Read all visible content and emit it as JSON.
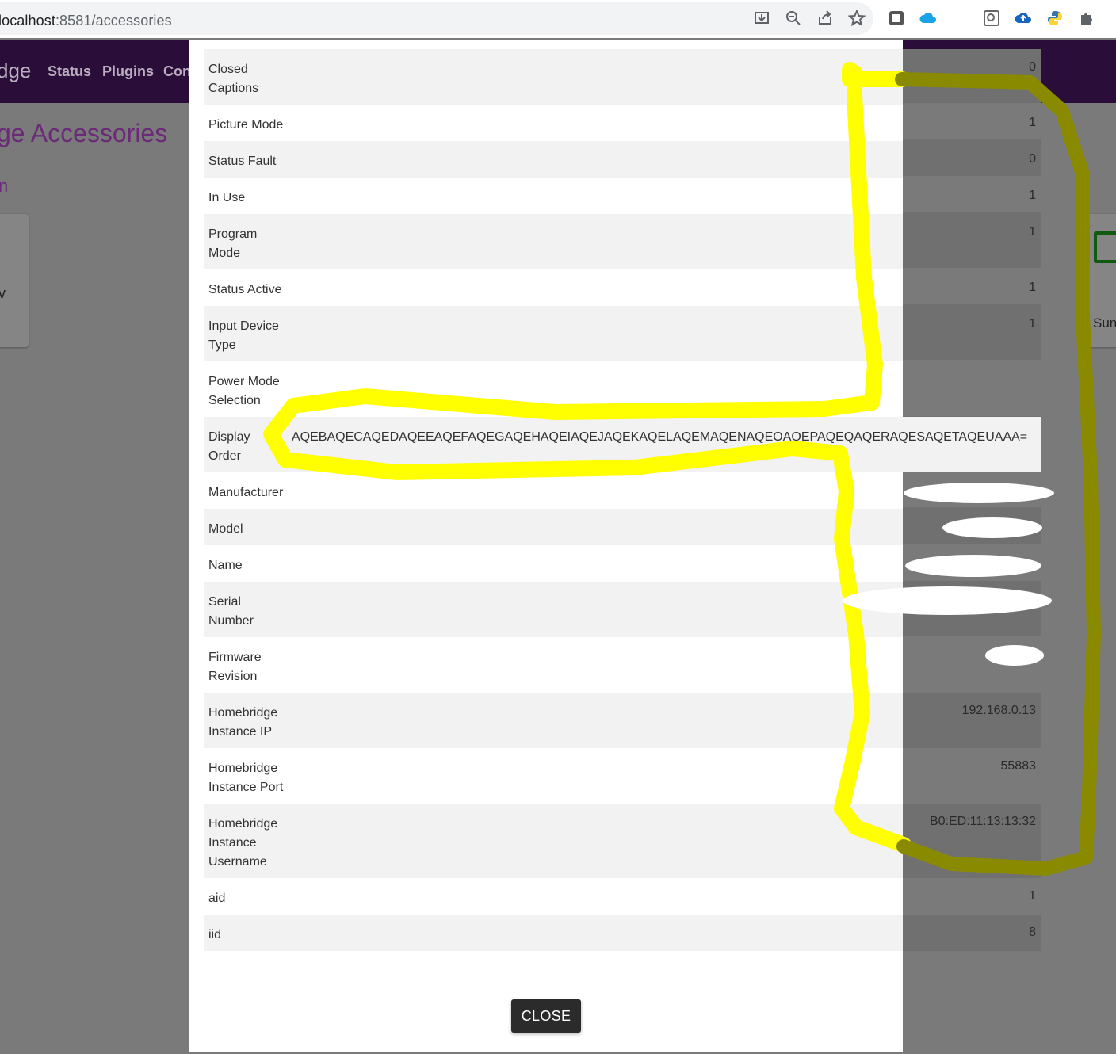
{
  "browser": {
    "url_host": "localhost",
    "url_path": ":8581/accessories"
  },
  "page": {
    "brand": "dge",
    "nav": [
      "Status",
      "Plugins",
      "Con"
    ],
    "title": "ge Accessories",
    "subtitle": "n",
    "left_card_text": "v",
    "right_card_text": "Sun"
  },
  "background_values": [
    "0",
    "1",
    "0",
    "1",
    "1",
    "1",
    "1",
    "192.168.0.13",
    "55883",
    "B0:ED:11:13:13:32",
    "1",
    "8"
  ],
  "modal": {
    "rows": [
      {
        "label": "Closed Captions",
        "value": ""
      },
      {
        "label": "Picture Mode",
        "value": ""
      },
      {
        "label": "Status Fault",
        "value": ""
      },
      {
        "label": "In Use",
        "value": ""
      },
      {
        "label": "Program Mode",
        "value": ""
      },
      {
        "label": "Status Active",
        "value": ""
      },
      {
        "label": "Input Device Type",
        "value": ""
      },
      {
        "label": "Power Mode Selection",
        "value": ""
      },
      {
        "label": "Display Order",
        "value": "AQEBAQECAQEDAQEEAQEFAQEGAQEHAQEIAQEJAQEKAQELAQEMAQENAQEOAQEPAQEQAQERAQESAQETAQEUAAA="
      },
      {
        "label": "Manufacturer",
        "value": ""
      },
      {
        "label": "Model",
        "value": ""
      },
      {
        "label": "Name",
        "value": ""
      },
      {
        "label": "Serial Number",
        "value": ""
      },
      {
        "label": "Firmware Revision",
        "value": ""
      },
      {
        "label": "Homebridge Instance IP",
        "value": ""
      },
      {
        "label": "Homebridge Instance Port",
        "value": ""
      },
      {
        "label": "Homebridge Instance Username",
        "value": ""
      },
      {
        "label": "aid",
        "value": ""
      },
      {
        "label": "iid",
        "value": ""
      }
    ],
    "close_label": "CLOSE"
  },
  "colors": {
    "header": "#2a0d38",
    "highlight": "#ffff00",
    "highlight_dim": "#8a8a00"
  }
}
